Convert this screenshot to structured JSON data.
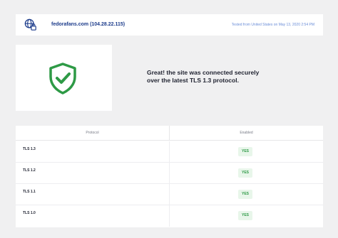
{
  "header": {
    "site_label": "fedorafans.com  (104.28.22.115)",
    "tested_prefix": "Tested from",
    "tested_location": "United States",
    "tested_on": "on",
    "tested_date": "May 13, 2020 2:54 PM",
    "globe_icon": "globe-lock-icon"
  },
  "result": {
    "shield_icon": "shield-check-icon",
    "accent_color": "#2e9a46",
    "message_line1": "Great! the site was connected securely",
    "message_line2": "over the latest TLS 1.3 protocol."
  },
  "table": {
    "headers": [
      "Protocol",
      "Enabled"
    ],
    "rows": [
      {
        "protocol": "TLS 1.3",
        "enabled": "YES"
      },
      {
        "protocol": "TLS 1.2",
        "enabled": "YES"
      },
      {
        "protocol": "TLS 1.1",
        "enabled": "YES"
      },
      {
        "protocol": "TLS 1.0",
        "enabled": "YES"
      }
    ]
  }
}
